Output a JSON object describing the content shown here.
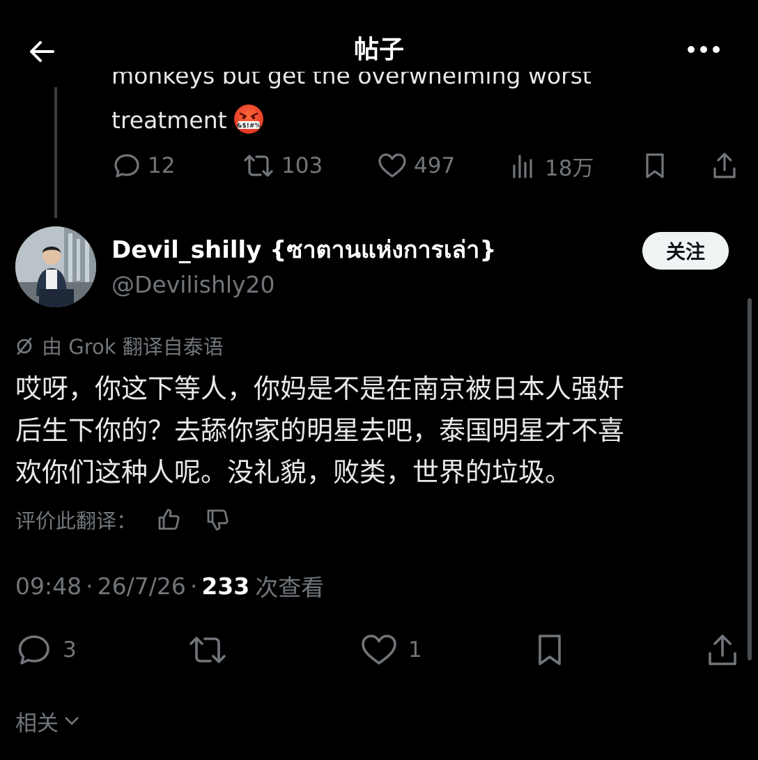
{
  "header": {
    "title": "帖子",
    "back_icon": "arrow-left-icon",
    "more_icon": "more-horizontal-icon"
  },
  "parent_tweet": {
    "clipped_text": "monkeys but get the overwhelming worst",
    "text": "treatment",
    "emoji_label": "&$!#%",
    "actions": {
      "replies": "12",
      "reposts": "103",
      "likes": "497",
      "views": "18万"
    }
  },
  "tweet": {
    "display_name": "Devil_shilly {ซาตานแห่งการเล่า}",
    "handle": "@Devilishly20",
    "follow_label": "关注",
    "translated_note": "由 Grok 翻译自泰语",
    "body_lines": [
      "哎呀，你这下等人，你妈是不是在南京被日本人强奸",
      "后生下你的？去舔你家的明星去吧，泰国明星才不喜",
      "欢你们这种人呢。没礼貌，败类，世界的垃圾。"
    ],
    "rate_translation_label": "评价此翻译：",
    "time": "09:48",
    "date": "26/7/26",
    "views_count": "233",
    "views_label": "次查看",
    "meta_sep": "·",
    "actions": {
      "replies": "3",
      "likes": "1"
    }
  },
  "related": {
    "label": "相关"
  },
  "colors": {
    "background": "#000000",
    "text_primary": "#e7e9ea",
    "text_secondary": "#71767b",
    "follow_button_bg": "#eff3f4"
  }
}
